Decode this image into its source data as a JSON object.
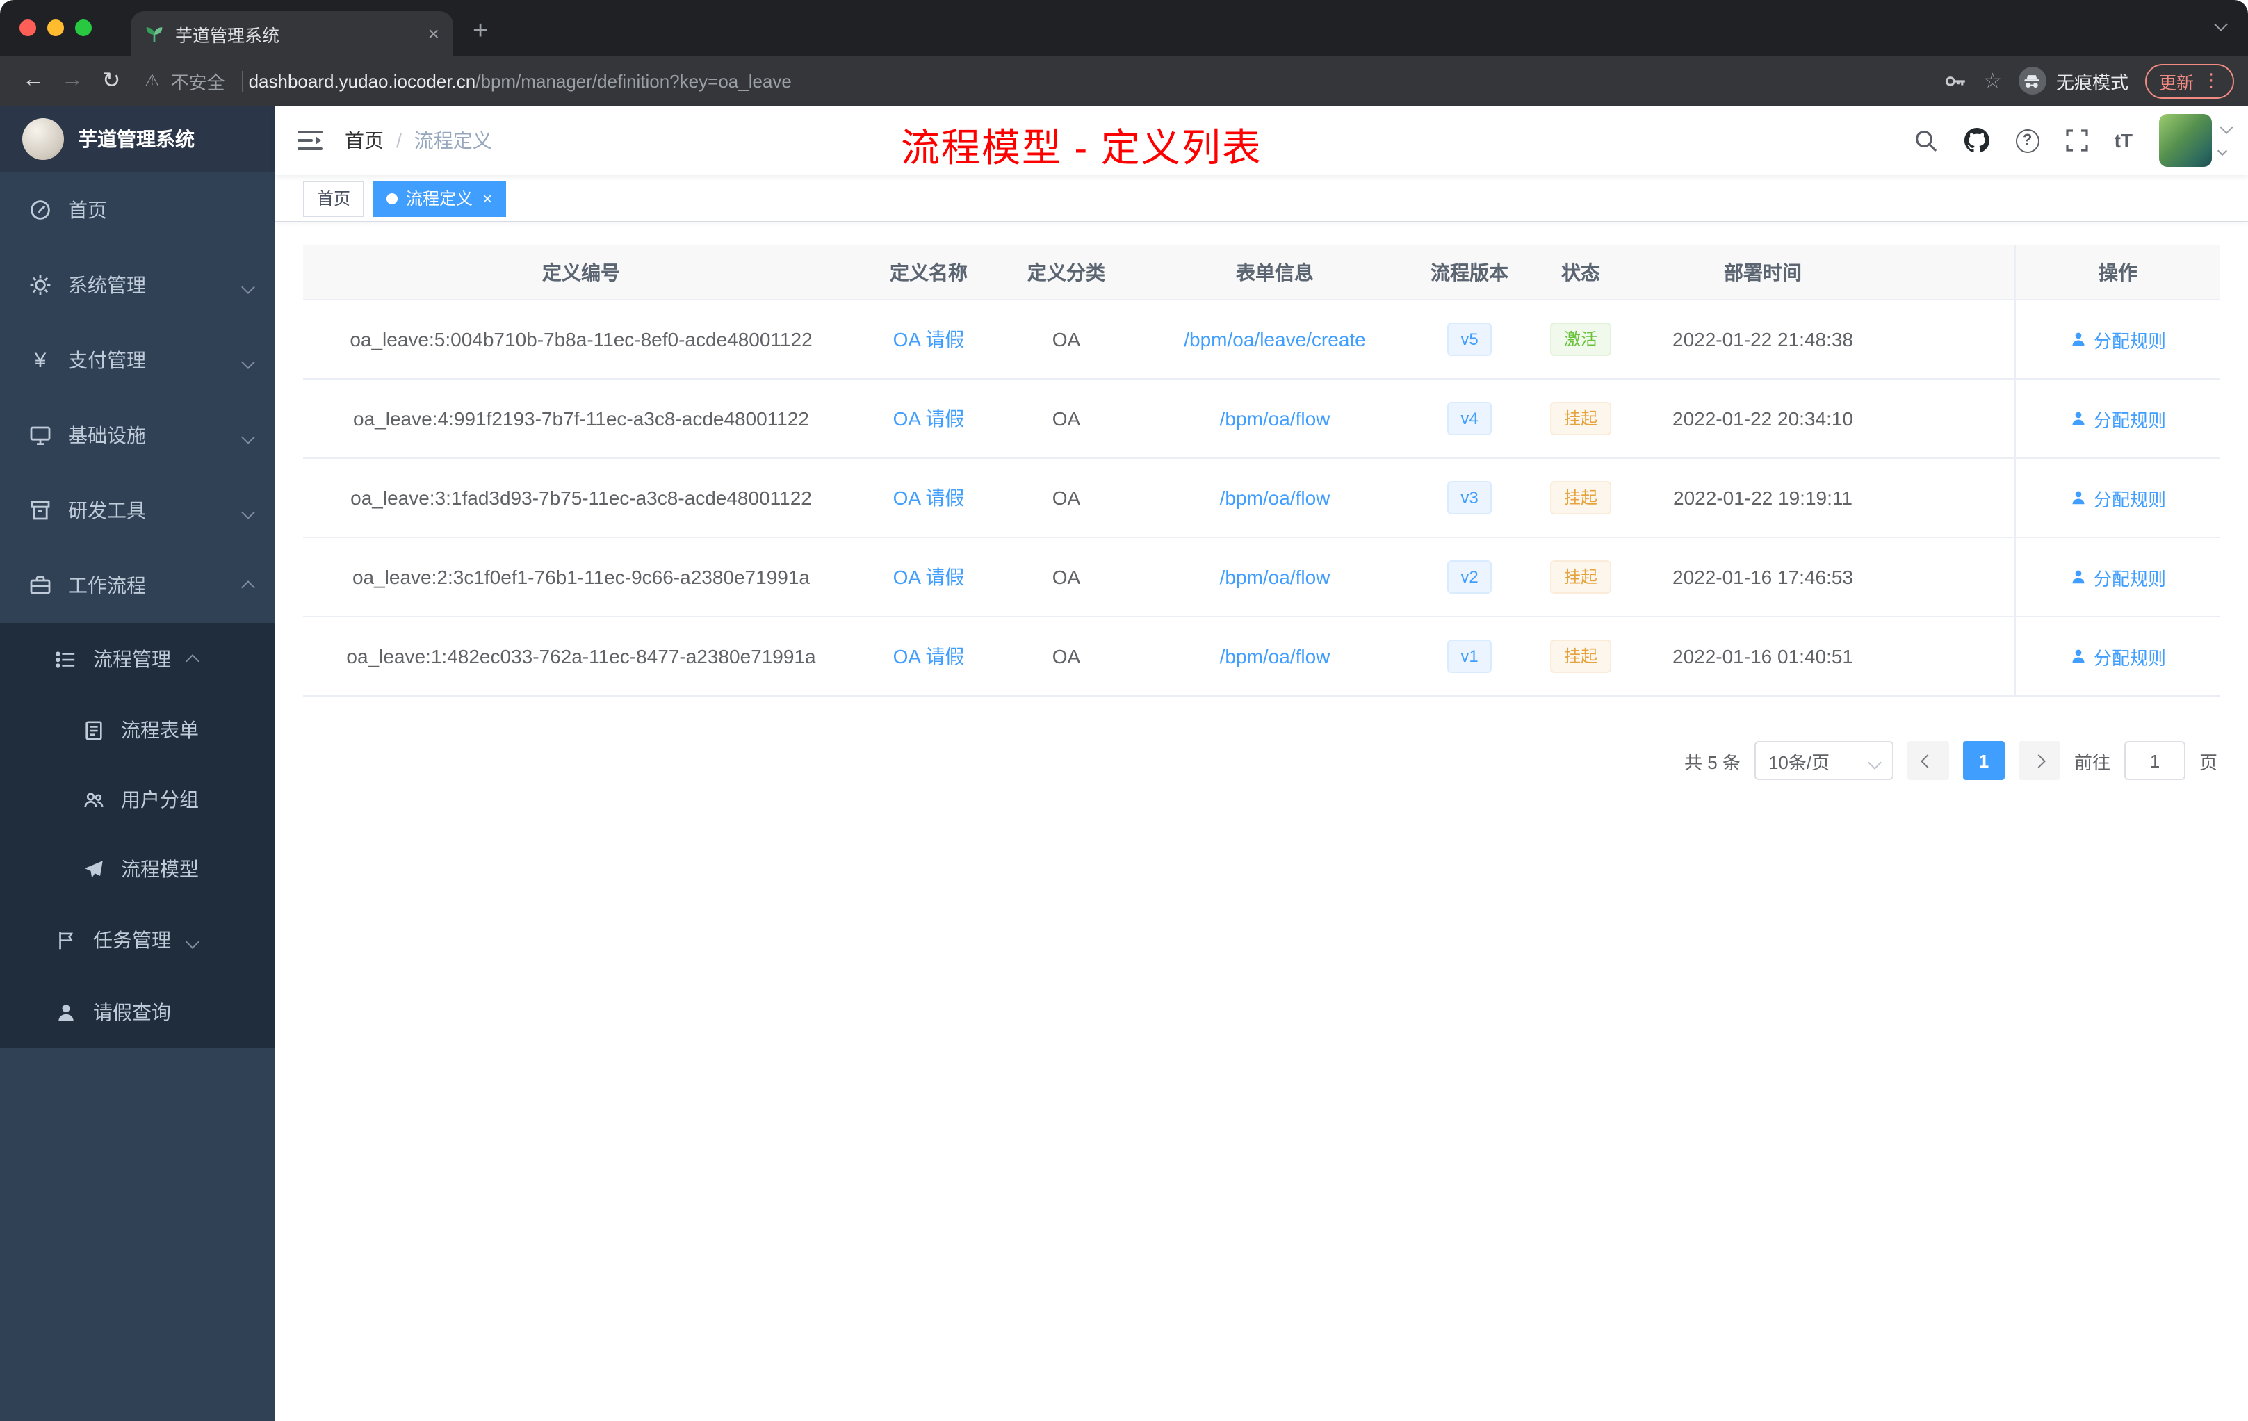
{
  "browser": {
    "tab_title": "芋道管理系统",
    "security_label": "不安全",
    "url_domain": "dashboard.yudao.iocoder.cn",
    "url_path": "/bpm/manager/definition?key=oa_leave",
    "incognito_label": "无痕模式",
    "update_label": "更新"
  },
  "glyphs": {
    "close": "×",
    "plus": "+",
    "back": "←",
    "forward": "→",
    "reload": "↻",
    "warning": "⚠",
    "star": "☆",
    "menu_dots": "⋮",
    "help": "?",
    "font_size": "tT"
  },
  "sidebar": {
    "logo_title": "芋道管理系统",
    "menu": [
      {
        "label": "首页"
      },
      {
        "label": "系统管理"
      },
      {
        "label": "支付管理"
      },
      {
        "label": "基础设施"
      },
      {
        "label": "研发工具"
      },
      {
        "label": "工作流程"
      }
    ],
    "submenu": [
      {
        "label": "流程管理"
      },
      {
        "label": "流程表单"
      },
      {
        "label": "用户分组"
      },
      {
        "label": "流程模型"
      },
      {
        "label": "任务管理"
      },
      {
        "label": "请假查询"
      }
    ]
  },
  "navbar": {
    "breadcrumb_home": "首页",
    "breadcrumb_sep": "/",
    "breadcrumb_current": "流程定义"
  },
  "annotation": "流程模型 - 定义列表",
  "tags": [
    {
      "label": "首页"
    },
    {
      "label": "流程定义"
    }
  ],
  "table": {
    "headers": [
      "定义编号",
      "定义名称",
      "定义分类",
      "表单信息",
      "流程版本",
      "状态",
      "部署时间",
      "操作"
    ],
    "rows": [
      {
        "id": "oa_leave:5:004b710b-7b8a-11ec-8ef0-acde48001122",
        "name": "OA 请假",
        "category": "OA",
        "form": "/bpm/oa/leave/create",
        "version": "v5",
        "status": "激活",
        "time": "2022-01-22 21:48:38",
        "action": "分配规则"
      },
      {
        "id": "oa_leave:4:991f2193-7b7f-11ec-a3c8-acde48001122",
        "name": "OA 请假",
        "category": "OA",
        "form": "/bpm/oa/flow",
        "version": "v4",
        "status": "挂起",
        "time": "2022-01-22 20:34:10",
        "action": "分配规则"
      },
      {
        "id": "oa_leave:3:1fad3d93-7b75-11ec-a3c8-acde48001122",
        "name": "OA 请假",
        "category": "OA",
        "form": "/bpm/oa/flow",
        "version": "v3",
        "status": "挂起",
        "time": "2022-01-22 19:19:11",
        "action": "分配规则"
      },
      {
        "id": "oa_leave:2:3c1f0ef1-76b1-11ec-9c66-a2380e71991a",
        "name": "OA 请假",
        "category": "OA",
        "form": "/bpm/oa/flow",
        "version": "v2",
        "status": "挂起",
        "time": "2022-01-16 17:46:53",
        "action": "分配规则"
      },
      {
        "id": "oa_leave:1:482ec033-762a-11ec-8477-a2380e71991a",
        "name": "OA 请假",
        "category": "OA",
        "form": "/bpm/oa/flow",
        "version": "v1",
        "status": "挂起",
        "time": "2022-01-16 01:40:51",
        "action": "分配规则"
      }
    ]
  },
  "pagination": {
    "total": "共 5 条",
    "page_size": "10条/页",
    "page": "1",
    "goto_label": "前往",
    "goto_value": "1",
    "page_unit": "页"
  },
  "colors": {
    "accent": "#409eff",
    "success": "#67c23a",
    "warning": "#e6a23c",
    "annotation": "#ff0000",
    "sidebar_bg": "#304156",
    "submenu_bg": "#1f2d3d"
  }
}
